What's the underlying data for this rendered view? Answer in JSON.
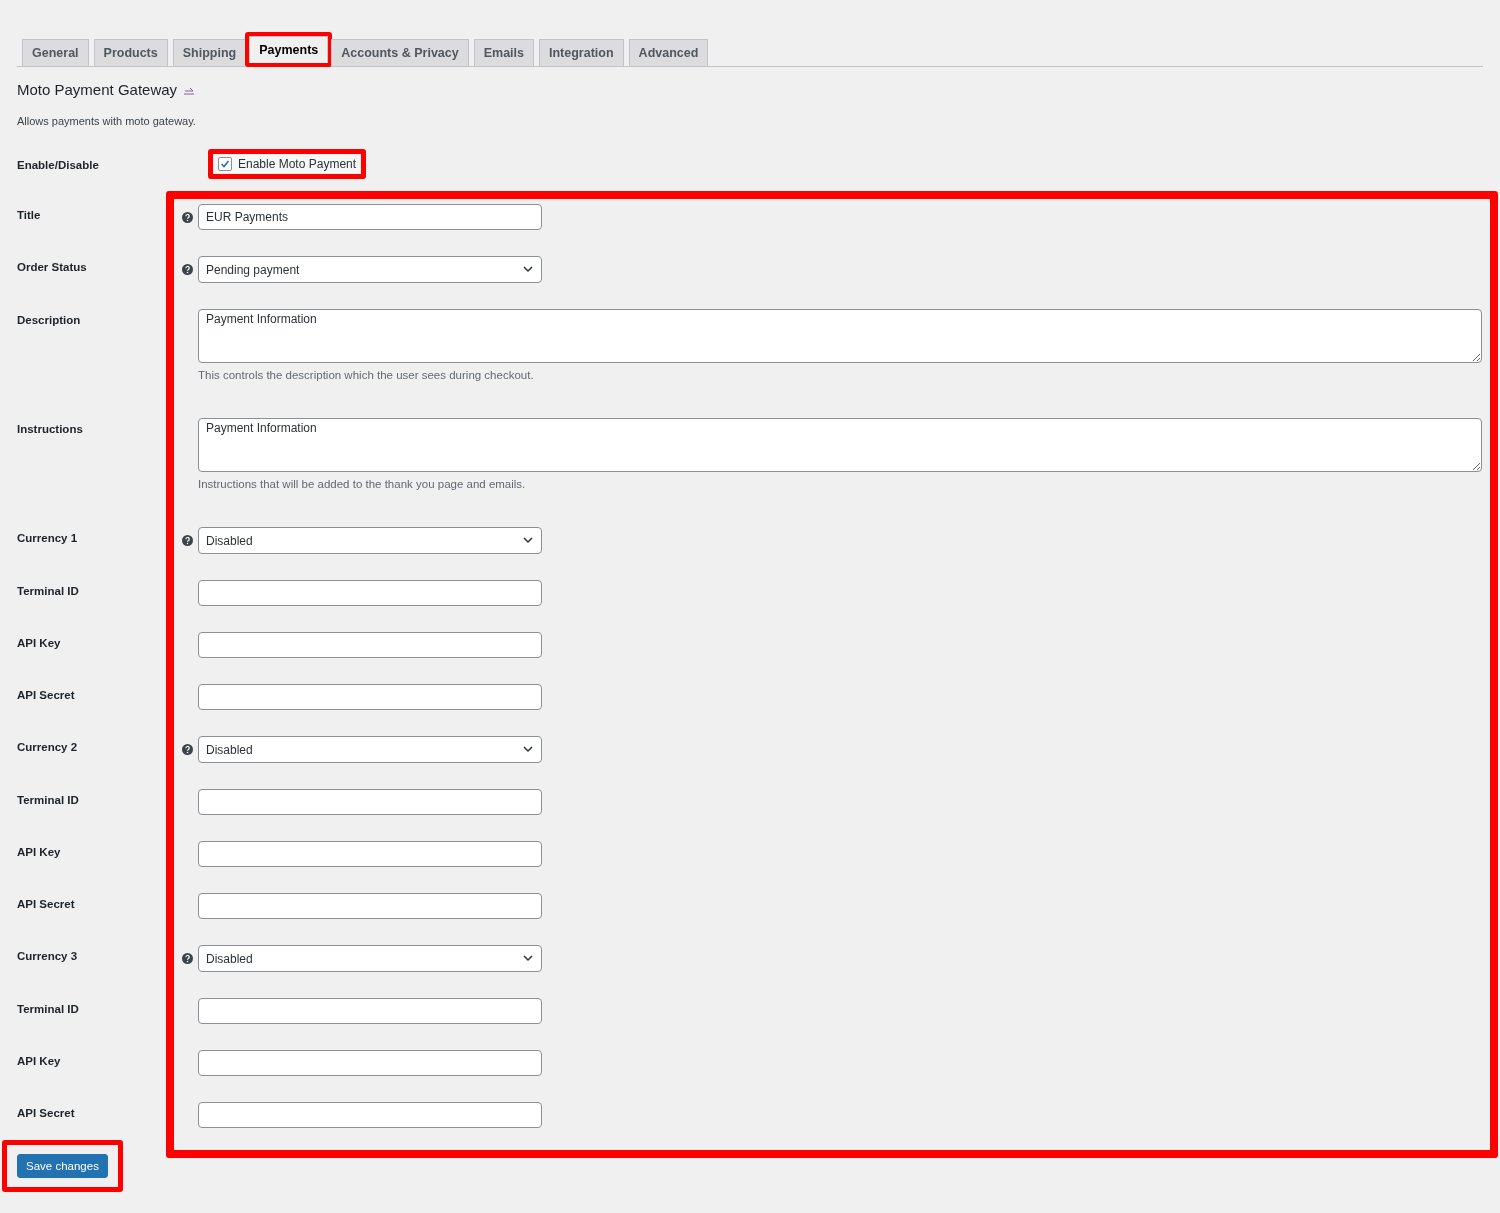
{
  "tabs": [
    {
      "label": "General",
      "selected": false,
      "highlighted": false
    },
    {
      "label": "Products",
      "selected": false,
      "highlighted": false
    },
    {
      "label": "Shipping",
      "selected": false,
      "highlighted": false
    },
    {
      "label": "Payments",
      "selected": true,
      "highlighted": true
    },
    {
      "label": "Accounts & Privacy",
      "selected": false,
      "highlighted": false
    },
    {
      "label": "Emails",
      "selected": false,
      "highlighted": false
    },
    {
      "label": "Integration",
      "selected": false,
      "highlighted": false
    },
    {
      "label": "Advanced",
      "selected": false,
      "highlighted": false
    }
  ],
  "section": {
    "title": "Moto Payment Gateway",
    "description": "Allows payments with moto gateway."
  },
  "enable": {
    "label": "Enable/Disable",
    "checkbox_label": "Enable Moto Payment",
    "checked": true,
    "highlighted": true
  },
  "fields_highlighted": true,
  "fields": [
    {
      "label": "Title",
      "kind": "text",
      "help": true,
      "value": "EUR Payments"
    },
    {
      "label": "Order Status",
      "kind": "select",
      "help": true,
      "value": "Pending payment"
    },
    {
      "label": "Description",
      "kind": "textarea",
      "help": false,
      "value": "Payment Information",
      "note": "This controls the description which the user sees during checkout."
    },
    {
      "label": "Instructions",
      "kind": "textarea",
      "help": false,
      "value": "Payment Information",
      "note": "Instructions that will be added to the thank you page and emails."
    },
    {
      "label": "Currency 1",
      "kind": "select",
      "help": true,
      "value": "Disabled"
    },
    {
      "label": "Terminal ID",
      "kind": "text",
      "help": false
    },
    {
      "label": "API Key",
      "kind": "text",
      "help": false
    },
    {
      "label": "API Secret",
      "kind": "text",
      "help": false
    },
    {
      "label": "Currency 2",
      "kind": "select",
      "help": true,
      "value": "Disabled"
    },
    {
      "label": "Terminal ID",
      "kind": "text",
      "help": false
    },
    {
      "label": "API Key",
      "kind": "text",
      "help": false
    },
    {
      "label": "API Secret",
      "kind": "text",
      "help": false
    },
    {
      "label": "Currency 3",
      "kind": "select",
      "help": true,
      "value": "Disabled"
    },
    {
      "label": "Terminal ID",
      "kind": "text",
      "help": false
    },
    {
      "label": "API Key",
      "kind": "text",
      "help": false
    },
    {
      "label": "API Secret",
      "kind": "text",
      "help": false
    }
  ],
  "save": {
    "label": "Save changes",
    "highlighted": true
  }
}
